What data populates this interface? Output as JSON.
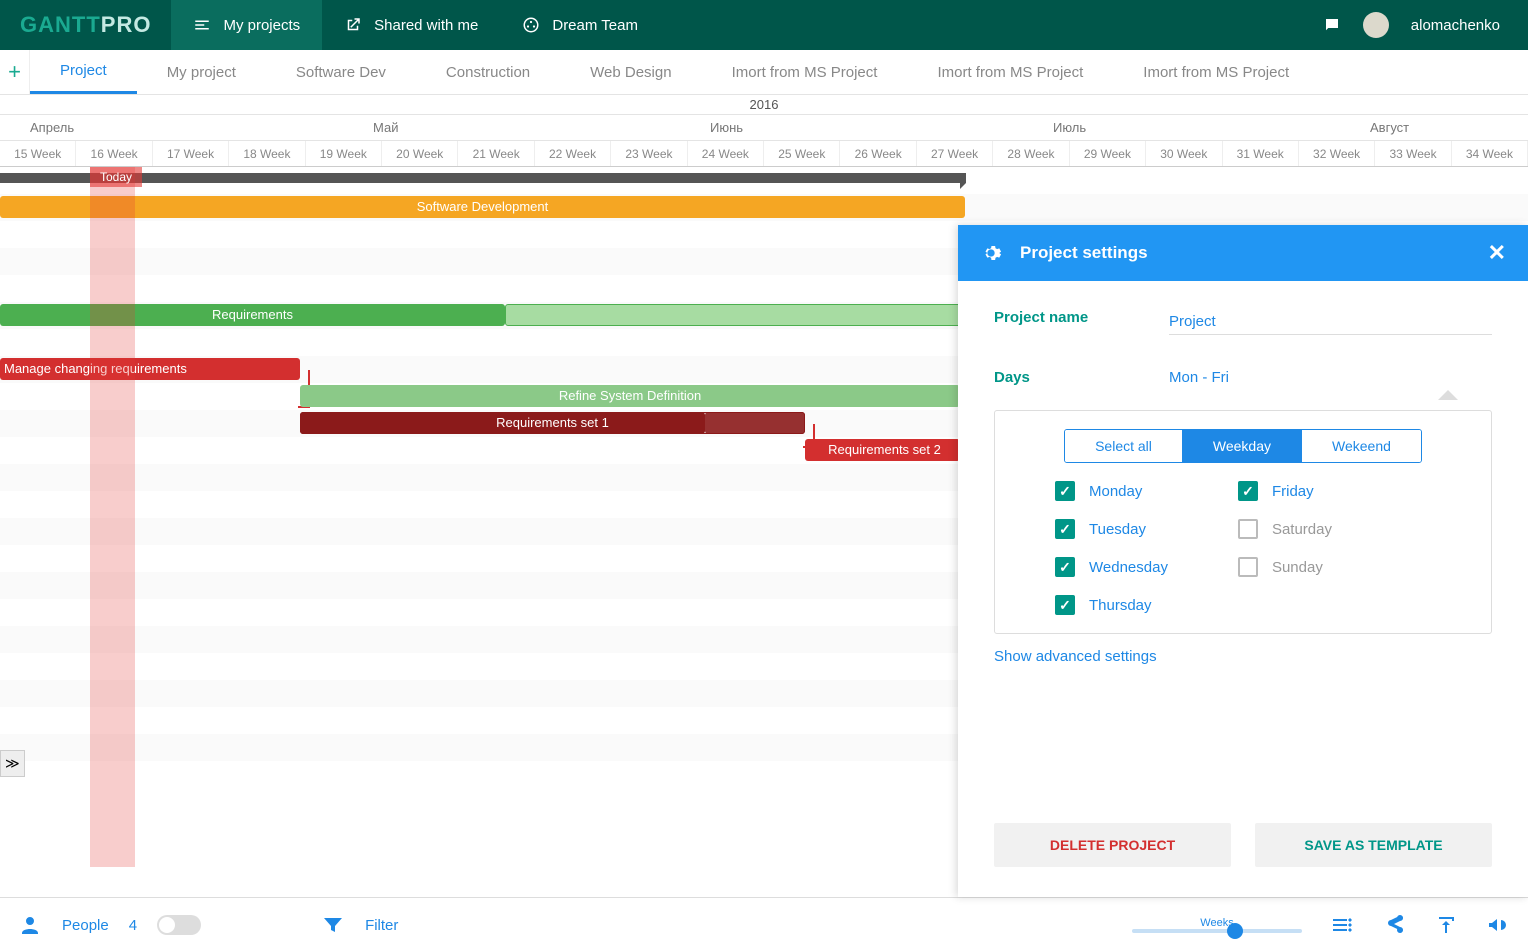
{
  "header": {
    "logo_a": "GANTT",
    "logo_b": "PRO",
    "nav": [
      {
        "label": "My projects",
        "icon": "menu",
        "active": true
      },
      {
        "label": "Shared with me",
        "icon": "share"
      },
      {
        "label": "Dream Team",
        "icon": "team"
      }
    ],
    "user": "alomachenko"
  },
  "tabs": [
    "Project",
    "My project",
    "Software Dev",
    "Construction",
    "Web Design",
    "Imort from MS Project",
    "Imort from MS Project",
    "Imort from MS Project"
  ],
  "timeline": {
    "year": "2016",
    "months": [
      "Апрель",
      "Май",
      "Июнь",
      "Июль",
      "Август"
    ],
    "weeks": [
      "15 Week",
      "16 Week",
      "17 Week",
      "18 Week",
      "19 Week",
      "20 Week",
      "21 Week",
      "22 Week",
      "23 Week",
      "24 Week",
      "25 Week",
      "26 Week",
      "27 Week",
      "28 Week",
      "29 Week",
      "30 Week",
      "31 Week",
      "32 Week",
      "33 Week",
      "34 Week"
    ],
    "today": "Today"
  },
  "bars": {
    "softdev": "Software Development",
    "requirements": "Requirements",
    "manage": "Manage changing requirements",
    "refine": "Refine System Definition",
    "set1": "Requirements set 1",
    "set2": "Requirements set 2"
  },
  "bottom": {
    "people_label": "People",
    "people_count": "4",
    "filter": "Filter",
    "zoom_label": "Weeks"
  },
  "panel": {
    "title": "Project settings",
    "name_label": "Project name",
    "name_value": "Project",
    "days_label": "Days",
    "days_value": "Mon - Fri",
    "seg": [
      "Select all",
      "Weekday",
      "Wekeend"
    ],
    "days": [
      {
        "name": "Monday",
        "on": true
      },
      {
        "name": "Tuesday",
        "on": true
      },
      {
        "name": "Wednesday",
        "on": true
      },
      {
        "name": "Thursday",
        "on": true
      },
      {
        "name": "Friday",
        "on": true
      },
      {
        "name": "Saturday",
        "on": false
      },
      {
        "name": "Sunday",
        "on": false
      }
    ],
    "advanced": "Show advanced settings",
    "delete": "DELETE PROJECT",
    "save": "SAVE AS TEMPLATE"
  }
}
